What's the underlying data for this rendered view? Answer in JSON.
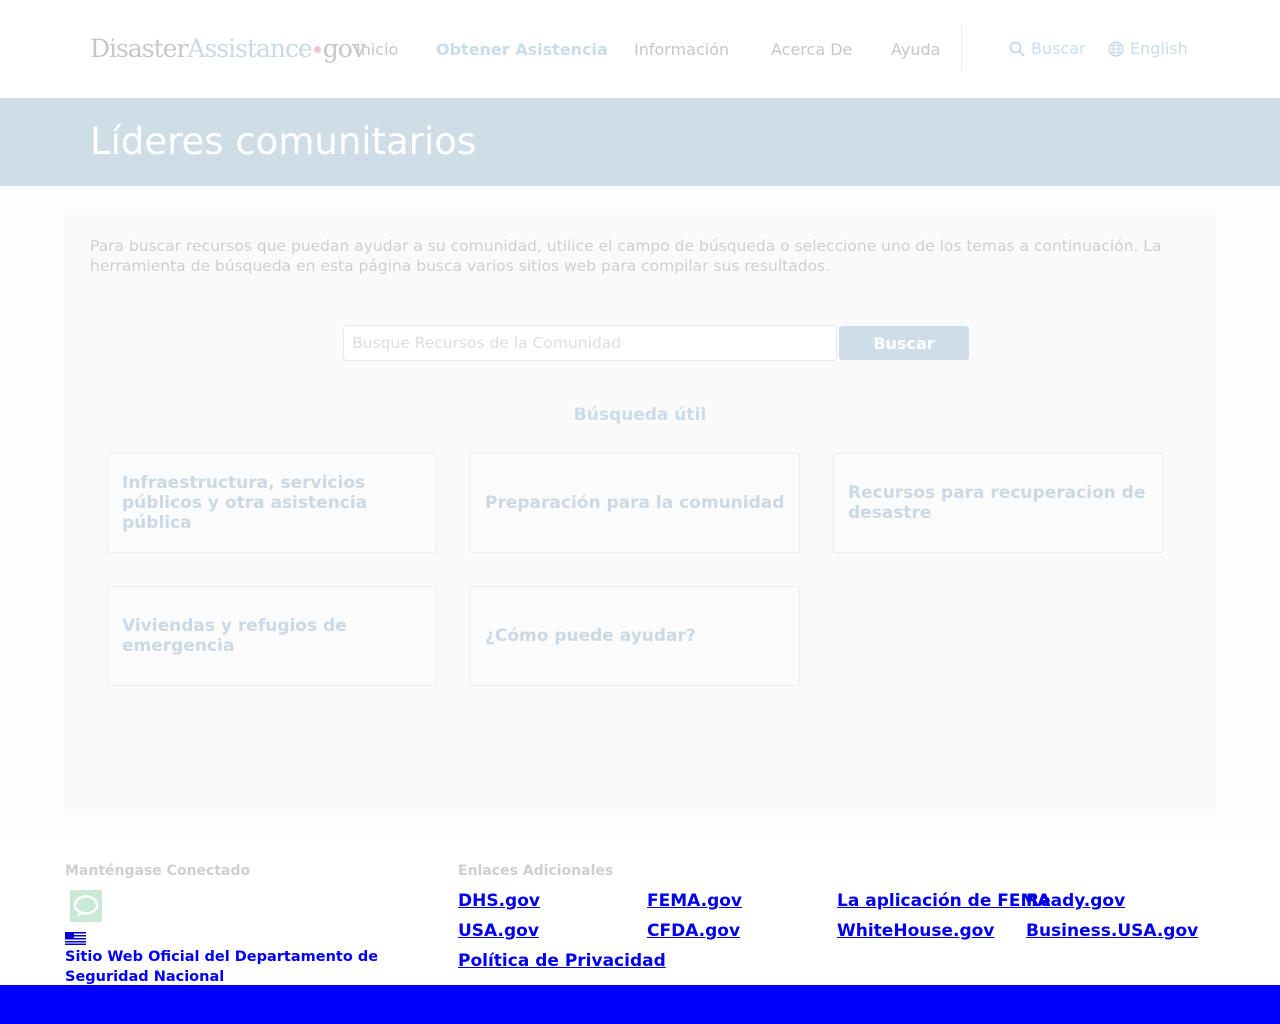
{
  "header": {
    "logo": {
      "part1": "Disaster",
      "part2": "Assistance",
      "part3": "gov"
    },
    "nav": [
      {
        "label": "Inicio",
        "active": false
      },
      {
        "label": "Obtener Asistencia",
        "active": true
      },
      {
        "label": "Información",
        "active": false
      },
      {
        "label": "Acerca De",
        "active": false
      },
      {
        "label": "Ayuda",
        "active": false
      }
    ],
    "search_label": "Buscar",
    "language_label": "English"
  },
  "banner": {
    "title": "Líderes comunitarios"
  },
  "main": {
    "intro": "Para buscar recursos que puedan ayudar a su comunidad, utilice el campo de búsqueda o seleccione uno de los temas a continuación. La herramienta de búsqueda en esta página busca varios sitios web para compilar sus resultados.",
    "search": {
      "placeholder": "Busque Recursos de la Comunidad",
      "value": "",
      "button_label": "Buscar"
    },
    "useful_heading": "Búsqueda útil",
    "topics": [
      {
        "label": "Infraestructura, servicios públicos y otra asistencia pública"
      },
      {
        "label": "Preparación para la comunidad"
      },
      {
        "label": "Recursos para recuperacion de desastre"
      },
      {
        "label": "Viviendas y refugios de emergencia"
      },
      {
        "label": "¿Cómo puede ayudar?"
      }
    ]
  },
  "footer": {
    "connect_heading": "Manténgase Conectado",
    "chat_icon": "chat-bubble-icon",
    "flag_icon": "us-flag-icon",
    "dhs_link": "Sitio Web Oficial del Departamento de Seguridad Nacional",
    "links_heading": "Enlaces Adicionales",
    "links": [
      {
        "label": "DHS.gov"
      },
      {
        "label": "FEMA.gov"
      },
      {
        "label": "La aplicación de FEMA"
      },
      {
        "label": "Ready.gov"
      },
      {
        "label": "USA.gov"
      },
      {
        "label": "CFDA.gov"
      },
      {
        "label": "WhiteHouse.gov"
      },
      {
        "label": "Business.USA.gov"
      },
      {
        "label": "Política de Privacidad"
      }
    ]
  },
  "colors": {
    "banner": "#cfdde7",
    "accent": "#c9dcea",
    "footer_link": "#0000ee",
    "bottom_bar": "#0000ff"
  }
}
